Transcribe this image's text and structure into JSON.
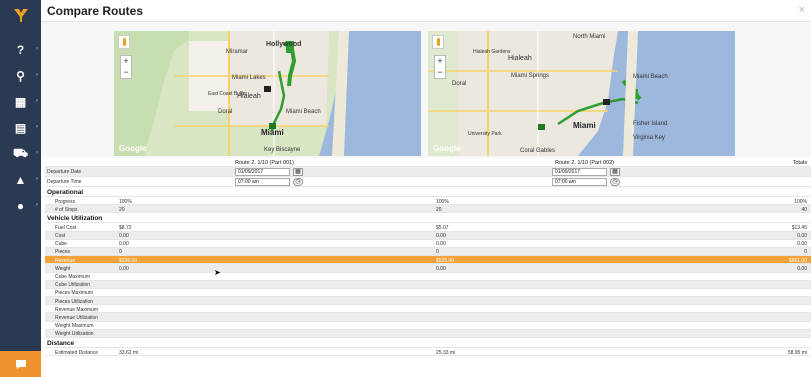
{
  "header": {
    "title": "Compare Routes",
    "close_label": "×"
  },
  "sidebar": {
    "items": [
      {
        "icon": "help-icon",
        "glyph": "?"
      },
      {
        "icon": "routes-icon",
        "glyph": "⚲"
      },
      {
        "icon": "cart-icon",
        "glyph": "▦"
      },
      {
        "icon": "documents-icon",
        "glyph": "▤"
      },
      {
        "icon": "truck-icon",
        "glyph": "⛟"
      },
      {
        "icon": "chart-icon",
        "glyph": "▲"
      },
      {
        "icon": "people-icon",
        "glyph": "●"
      }
    ],
    "chat_icon": "chat-icon"
  },
  "maps": [
    {
      "google": "Google",
      "zoom_in": "+",
      "zoom_out": "−",
      "labels": {
        "hollywood": "Hollywood",
        "miramar": "Miramar",
        "miami_lakes": "Miami Lakes",
        "hialeah": "Hialeah",
        "doral": "Doral",
        "miami_beach": "Miami Beach",
        "miami": "Miami",
        "key_biscayne": "Key Biscayne",
        "east_coast": "East Coast Buffer"
      }
    },
    {
      "google": "Google",
      "zoom_in": "+",
      "zoom_out": "−",
      "labels": {
        "north_miami": "North Miami",
        "hialeah_gardens": "Hialeah Gardens",
        "hialeah": "Hialeah",
        "miami_springs": "Miami Springs",
        "doral": "Doral",
        "miami_beach": "Miami Beach",
        "miami": "Miami",
        "fisher_island": "Fisher Island",
        "virginia_key": "Virginia Key",
        "coral_gables": "Coral Gables",
        "university_park": "University Park"
      }
    }
  ],
  "columns": {
    "route1": "Route 2, 1/10 (Part 001)",
    "route2": "Route 2, 1/10 (Part 002)",
    "totals": "Totals"
  },
  "departure_date": {
    "label": "Departure Date",
    "route1": "01/09/2017",
    "route2": "01/09/2017"
  },
  "departure_time": {
    "label": "Departure Time",
    "route1": "07:00 am",
    "route2": "07:00 am"
  },
  "sections": {
    "operational": {
      "title": "Operational",
      "rows": [
        {
          "label": "Progress",
          "v1": "100%",
          "v2": "100%",
          "total": "100%"
        },
        {
          "label": "# of Stops",
          "v1": "20",
          "v2": "20",
          "total": "40"
        }
      ]
    },
    "vehicle": {
      "title": "Vehicle Utilization",
      "rows": [
        {
          "label": "Fuel Cost",
          "v1": "$8.72",
          "v2": "$5.07",
          "total": "$13.45"
        },
        {
          "label": "Cost",
          "v1": "0.00",
          "v2": "0.00",
          "total": "0.00"
        },
        {
          "label": "Cube",
          "v1": "0.00",
          "v2": "0.00",
          "total": "0.00"
        },
        {
          "label": "Pieces",
          "v1": "0",
          "v2": "0",
          "total": "0"
        },
        {
          "label": "Revenue",
          "v1": "$336.00",
          "v2": "$525.00",
          "total": "$861.00"
        },
        {
          "label": "Weight",
          "v1": "0.00",
          "v2": "0.00",
          "total": "0.00"
        },
        {
          "label": "Cube Maximum",
          "v1": "",
          "v2": "",
          "total": ""
        },
        {
          "label": "Cube Utilization",
          "v1": "",
          "v2": "",
          "total": ""
        },
        {
          "label": "Pieces Maximum",
          "v1": "",
          "v2": "",
          "total": ""
        },
        {
          "label": "Pieces Utilization",
          "v1": "",
          "v2": "",
          "total": ""
        },
        {
          "label": "Revenue Maximum",
          "v1": "",
          "v2": "",
          "total": ""
        },
        {
          "label": "Revenue Utilization",
          "v1": "",
          "v2": "",
          "total": ""
        },
        {
          "label": "Weight Maximum",
          "v1": "",
          "v2": "",
          "total": ""
        },
        {
          "label": "Weight Utilization",
          "v1": "",
          "v2": "",
          "total": ""
        }
      ]
    },
    "distance": {
      "title": "Distance",
      "rows": [
        {
          "label": "Estimated Distance",
          "v1": "33.62 mi",
          "v2": "25.33 mi",
          "total": "58.95 mi"
        }
      ]
    }
  },
  "colors": {
    "sidebar": "#2a3a52",
    "accent": "#f4a23a",
    "route": "#2e9e2e"
  }
}
